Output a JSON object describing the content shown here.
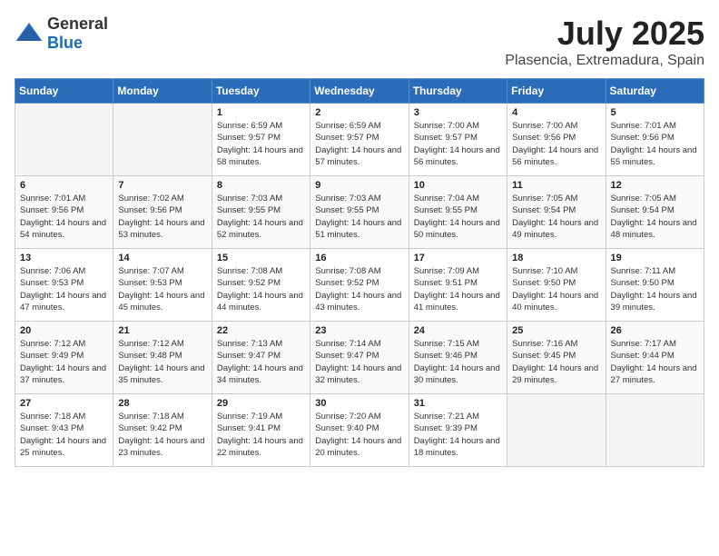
{
  "logo": {
    "text_general": "General",
    "text_blue": "Blue"
  },
  "title": "July 2025",
  "location": "Plasencia, Extremadura, Spain",
  "days_of_week": [
    "Sunday",
    "Monday",
    "Tuesday",
    "Wednesday",
    "Thursday",
    "Friday",
    "Saturday"
  ],
  "weeks": [
    [
      {
        "day": "",
        "sunrise": "",
        "sunset": "",
        "daylight": ""
      },
      {
        "day": "",
        "sunrise": "",
        "sunset": "",
        "daylight": ""
      },
      {
        "day": "1",
        "sunrise": "Sunrise: 6:59 AM",
        "sunset": "Sunset: 9:57 PM",
        "daylight": "Daylight: 14 hours and 58 minutes."
      },
      {
        "day": "2",
        "sunrise": "Sunrise: 6:59 AM",
        "sunset": "Sunset: 9:57 PM",
        "daylight": "Daylight: 14 hours and 57 minutes."
      },
      {
        "day": "3",
        "sunrise": "Sunrise: 7:00 AM",
        "sunset": "Sunset: 9:57 PM",
        "daylight": "Daylight: 14 hours and 56 minutes."
      },
      {
        "day": "4",
        "sunrise": "Sunrise: 7:00 AM",
        "sunset": "Sunset: 9:56 PM",
        "daylight": "Daylight: 14 hours and 56 minutes."
      },
      {
        "day": "5",
        "sunrise": "Sunrise: 7:01 AM",
        "sunset": "Sunset: 9:56 PM",
        "daylight": "Daylight: 14 hours and 55 minutes."
      }
    ],
    [
      {
        "day": "6",
        "sunrise": "Sunrise: 7:01 AM",
        "sunset": "Sunset: 9:56 PM",
        "daylight": "Daylight: 14 hours and 54 minutes."
      },
      {
        "day": "7",
        "sunrise": "Sunrise: 7:02 AM",
        "sunset": "Sunset: 9:56 PM",
        "daylight": "Daylight: 14 hours and 53 minutes."
      },
      {
        "day": "8",
        "sunrise": "Sunrise: 7:03 AM",
        "sunset": "Sunset: 9:55 PM",
        "daylight": "Daylight: 14 hours and 52 minutes."
      },
      {
        "day": "9",
        "sunrise": "Sunrise: 7:03 AM",
        "sunset": "Sunset: 9:55 PM",
        "daylight": "Daylight: 14 hours and 51 minutes."
      },
      {
        "day": "10",
        "sunrise": "Sunrise: 7:04 AM",
        "sunset": "Sunset: 9:55 PM",
        "daylight": "Daylight: 14 hours and 50 minutes."
      },
      {
        "day": "11",
        "sunrise": "Sunrise: 7:05 AM",
        "sunset": "Sunset: 9:54 PM",
        "daylight": "Daylight: 14 hours and 49 minutes."
      },
      {
        "day": "12",
        "sunrise": "Sunrise: 7:05 AM",
        "sunset": "Sunset: 9:54 PM",
        "daylight": "Daylight: 14 hours and 48 minutes."
      }
    ],
    [
      {
        "day": "13",
        "sunrise": "Sunrise: 7:06 AM",
        "sunset": "Sunset: 9:53 PM",
        "daylight": "Daylight: 14 hours and 47 minutes."
      },
      {
        "day": "14",
        "sunrise": "Sunrise: 7:07 AM",
        "sunset": "Sunset: 9:53 PM",
        "daylight": "Daylight: 14 hours and 45 minutes."
      },
      {
        "day": "15",
        "sunrise": "Sunrise: 7:08 AM",
        "sunset": "Sunset: 9:52 PM",
        "daylight": "Daylight: 14 hours and 44 minutes."
      },
      {
        "day": "16",
        "sunrise": "Sunrise: 7:08 AM",
        "sunset": "Sunset: 9:52 PM",
        "daylight": "Daylight: 14 hours and 43 minutes."
      },
      {
        "day": "17",
        "sunrise": "Sunrise: 7:09 AM",
        "sunset": "Sunset: 9:51 PM",
        "daylight": "Daylight: 14 hours and 41 minutes."
      },
      {
        "day": "18",
        "sunrise": "Sunrise: 7:10 AM",
        "sunset": "Sunset: 9:50 PM",
        "daylight": "Daylight: 14 hours and 40 minutes."
      },
      {
        "day": "19",
        "sunrise": "Sunrise: 7:11 AM",
        "sunset": "Sunset: 9:50 PM",
        "daylight": "Daylight: 14 hours and 39 minutes."
      }
    ],
    [
      {
        "day": "20",
        "sunrise": "Sunrise: 7:12 AM",
        "sunset": "Sunset: 9:49 PM",
        "daylight": "Daylight: 14 hours and 37 minutes."
      },
      {
        "day": "21",
        "sunrise": "Sunrise: 7:12 AM",
        "sunset": "Sunset: 9:48 PM",
        "daylight": "Daylight: 14 hours and 35 minutes."
      },
      {
        "day": "22",
        "sunrise": "Sunrise: 7:13 AM",
        "sunset": "Sunset: 9:47 PM",
        "daylight": "Daylight: 14 hours and 34 minutes."
      },
      {
        "day": "23",
        "sunrise": "Sunrise: 7:14 AM",
        "sunset": "Sunset: 9:47 PM",
        "daylight": "Daylight: 14 hours and 32 minutes."
      },
      {
        "day": "24",
        "sunrise": "Sunrise: 7:15 AM",
        "sunset": "Sunset: 9:46 PM",
        "daylight": "Daylight: 14 hours and 30 minutes."
      },
      {
        "day": "25",
        "sunrise": "Sunrise: 7:16 AM",
        "sunset": "Sunset: 9:45 PM",
        "daylight": "Daylight: 14 hours and 29 minutes."
      },
      {
        "day": "26",
        "sunrise": "Sunrise: 7:17 AM",
        "sunset": "Sunset: 9:44 PM",
        "daylight": "Daylight: 14 hours and 27 minutes."
      }
    ],
    [
      {
        "day": "27",
        "sunrise": "Sunrise: 7:18 AM",
        "sunset": "Sunset: 9:43 PM",
        "daylight": "Daylight: 14 hours and 25 minutes."
      },
      {
        "day": "28",
        "sunrise": "Sunrise: 7:18 AM",
        "sunset": "Sunset: 9:42 PM",
        "daylight": "Daylight: 14 hours and 23 minutes."
      },
      {
        "day": "29",
        "sunrise": "Sunrise: 7:19 AM",
        "sunset": "Sunset: 9:41 PM",
        "daylight": "Daylight: 14 hours and 22 minutes."
      },
      {
        "day": "30",
        "sunrise": "Sunrise: 7:20 AM",
        "sunset": "Sunset: 9:40 PM",
        "daylight": "Daylight: 14 hours and 20 minutes."
      },
      {
        "day": "31",
        "sunrise": "Sunrise: 7:21 AM",
        "sunset": "Sunset: 9:39 PM",
        "daylight": "Daylight: 14 hours and 18 minutes."
      },
      {
        "day": "",
        "sunrise": "",
        "sunset": "",
        "daylight": ""
      },
      {
        "day": "",
        "sunrise": "",
        "sunset": "",
        "daylight": ""
      }
    ]
  ]
}
